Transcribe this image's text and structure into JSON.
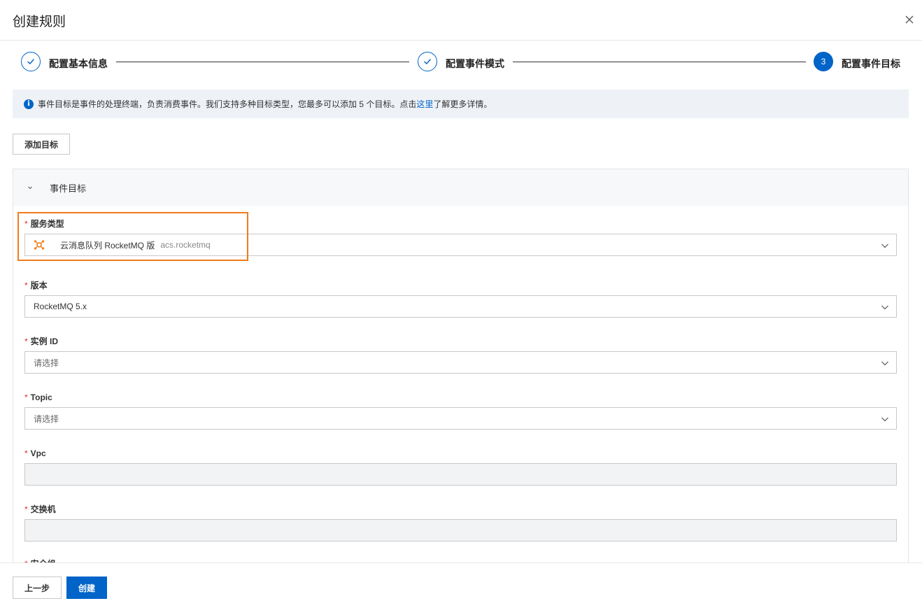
{
  "header": {
    "title": "创建规则"
  },
  "steps": [
    {
      "label": "配置基本信息",
      "status": "done"
    },
    {
      "label": "配置事件模式",
      "status": "done"
    },
    {
      "label": "配置事件目标",
      "status": "active",
      "number": "3"
    }
  ],
  "info": {
    "text_before": "事件目标是事件的处理终端，负责消费事件。我们支持多种目标类型，您最多可以添加 5 个目标。点击",
    "link": "这里",
    "text_after": "了解更多详情。"
  },
  "add_target_label": "添加目标",
  "panel": {
    "title": "事件目标",
    "fields": {
      "service_type": {
        "label": "服务类型",
        "value": "云消息队列 RocketMQ 版",
        "sub": "acs.rocketmq"
      },
      "version": {
        "label": "版本",
        "value": "RocketMQ 5.x"
      },
      "instance_id": {
        "label": "实例 ID",
        "placeholder": "请选择"
      },
      "topic": {
        "label": "Topic",
        "placeholder": "请选择"
      },
      "vpc": {
        "label": "Vpc",
        "value": ""
      },
      "vswitch": {
        "label": "交换机",
        "value": ""
      },
      "security_group": {
        "label": "安全组"
      }
    },
    "required_mark": "*"
  },
  "footer": {
    "prev_label": "上一步",
    "create_label": "创建"
  },
  "colors": {
    "primary": "#0064c8",
    "highlight": "#f07c1c",
    "required": "#d93026",
    "service_icon": "#f07c1c"
  }
}
